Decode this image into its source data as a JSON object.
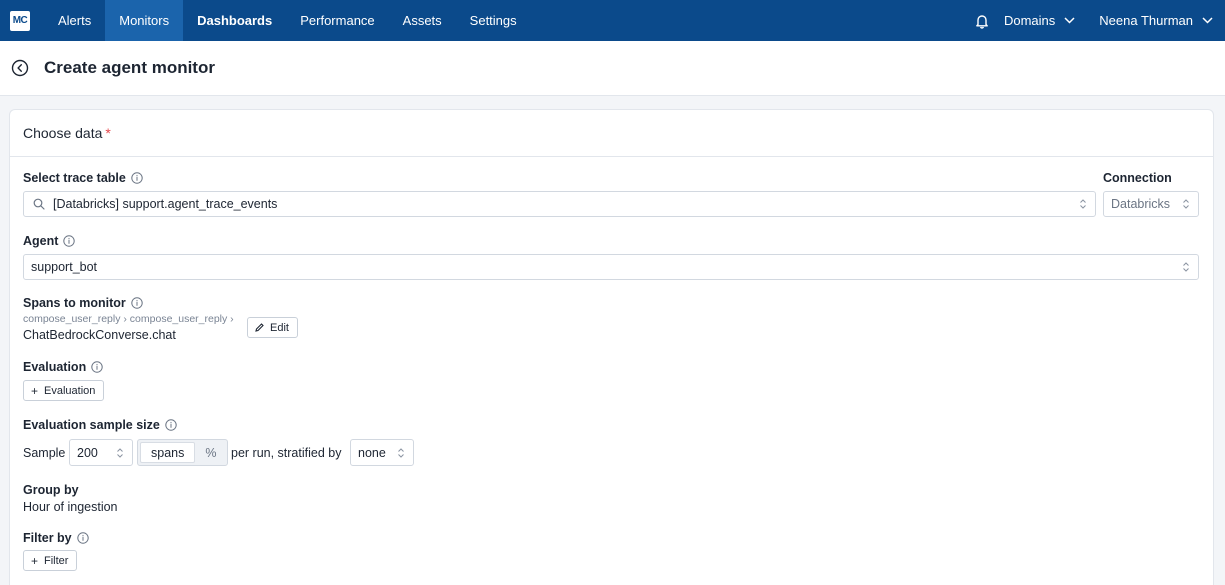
{
  "nav": {
    "logo": "MC",
    "items": [
      {
        "label": "Alerts"
      },
      {
        "label": "Monitors"
      },
      {
        "label": "Dashboards"
      },
      {
        "label": "Performance"
      },
      {
        "label": "Assets"
      },
      {
        "label": "Settings"
      }
    ],
    "active": "Monitors",
    "domains_label": "Domains",
    "user_name": "Neena Thurman"
  },
  "header": {
    "title": "Create agent monitor"
  },
  "card": {
    "title": "Choose data",
    "required_mark": "*",
    "trace_table": {
      "label": "Select trace table",
      "value": "[Databricks] support.agent_trace_events"
    },
    "connection": {
      "label": "Connection",
      "value": "Databricks"
    },
    "agent": {
      "label": "Agent",
      "value": "support_bot"
    },
    "spans": {
      "label": "Spans to monitor",
      "path": "compose_user_reply › compose_user_reply ›",
      "leaf": "ChatBedrockConverse.chat",
      "edit_label": "Edit"
    },
    "evaluation": {
      "label": "Evaluation",
      "button": "Evaluation"
    },
    "sample": {
      "label": "Evaluation sample size",
      "prefix": "Sample",
      "value": "200",
      "unit_options": [
        "spans",
        "%"
      ],
      "unit_selected": "spans",
      "middle": "per run, stratified by",
      "stratify": "none"
    },
    "group_by": {
      "label": "Group by",
      "value": "Hour of ingestion"
    },
    "filter_by": {
      "label": "Filter by",
      "button": "Filter"
    }
  },
  "colors": {
    "nav_bg": "#0b4a8b",
    "nav_active": "#1b64ac",
    "required": "#e5484d"
  }
}
